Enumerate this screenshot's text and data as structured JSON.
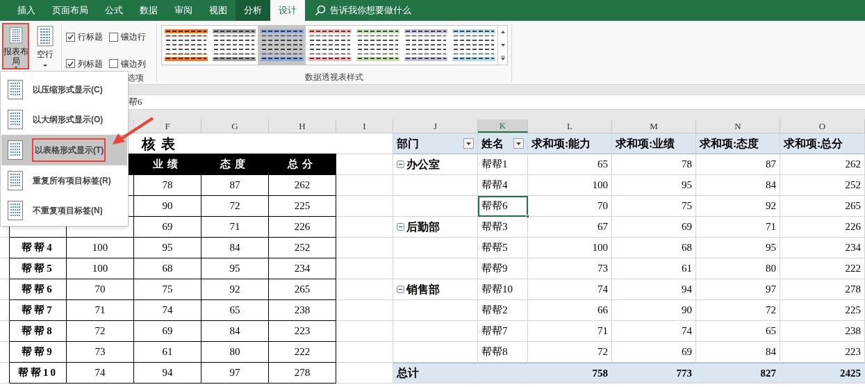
{
  "ribbon_tabs": [
    {
      "label": "插入",
      "kind": "normal",
      "selected": false
    },
    {
      "label": "页面布局",
      "kind": "normal",
      "selected": false
    },
    {
      "label": "公式",
      "kind": "normal",
      "selected": false
    },
    {
      "label": "数据",
      "kind": "normal",
      "selected": false
    },
    {
      "label": "审阅",
      "kind": "normal",
      "selected": false
    },
    {
      "label": "视图",
      "kind": "normal",
      "selected": false
    },
    {
      "label": "分析",
      "kind": "contextual",
      "selected": false
    },
    {
      "label": "设计",
      "kind": "contextual",
      "selected": true
    }
  ],
  "tell_me": {
    "placeholder": "告诉我你想要做什么"
  },
  "ribbon": {
    "layout_button": {
      "label": "报表布局",
      "pressed": true
    },
    "blank_rows_button": {
      "label": "空行"
    },
    "options": [
      {
        "label": "行标题",
        "checked": true
      },
      {
        "label": "镶边行",
        "checked": false
      },
      {
        "label": "列标题",
        "checked": true
      },
      {
        "label": "镶边列",
        "checked": false
      }
    ],
    "options_group_label": "选项",
    "styles": [
      {
        "color": "#ed7d31",
        "selected": false
      },
      {
        "color": "#a5a5a5",
        "selected": false
      },
      {
        "color": "#8eaadb",
        "selected": true
      },
      {
        "color": "#f4b6b6",
        "selected": false
      },
      {
        "color": "#c5e0b4",
        "selected": false
      },
      {
        "color": "#c9c0e0",
        "selected": false
      },
      {
        "color": "#b4dde9",
        "selected": false
      }
    ],
    "styles_group_label": "数据透视表样式"
  },
  "menu": {
    "items": [
      {
        "label": "以压缩形式显示(C)",
        "selected": false
      },
      {
        "label": "以大纲形式显示(O)",
        "selected": false
      },
      {
        "label": "以表格形式显示(T)",
        "selected": true
      },
      {
        "label": "重复所有项目标签(R)",
        "selected": false
      },
      {
        "label": "不重复项目标签(N)",
        "selected": false
      }
    ]
  },
  "formula_bar": {
    "value": "帮6"
  },
  "column_headers": [
    {
      "label": "F",
      "selected": false
    },
    {
      "label": "G",
      "selected": false
    },
    {
      "label": "H",
      "selected": false
    },
    {
      "label": "I",
      "selected": false
    },
    {
      "label": "J",
      "selected": false
    },
    {
      "label": "K",
      "selected": true
    },
    {
      "label": "L",
      "selected": false
    },
    {
      "label": "M",
      "selected": false
    },
    {
      "label": "N",
      "selected": false
    },
    {
      "label": "O",
      "selected": false
    }
  ],
  "score_table": {
    "title": "核表",
    "headers": [
      "业绩",
      "态度",
      "总分"
    ],
    "rows": [
      {
        "values": [
          "78",
          "87",
          "262"
        ]
      },
      {
        "values": [
          "90",
          "72",
          "225"
        ]
      },
      {
        "values": [
          "69",
          "71",
          "226"
        ]
      },
      {
        "name": "帮帮4",
        "ability": "100",
        "values": [
          "95",
          "84",
          "252"
        ]
      },
      {
        "name": "帮帮5",
        "ability": "100",
        "values": [
          "68",
          "95",
          "234"
        ]
      },
      {
        "name": "帮帮6",
        "ability": "70",
        "values": [
          "75",
          "92",
          "265"
        ]
      },
      {
        "name": "帮帮7",
        "ability": "71",
        "values": [
          "74",
          "65",
          "238"
        ]
      },
      {
        "name": "帮帮8",
        "ability": "72",
        "values": [
          "69",
          "84",
          "223"
        ]
      },
      {
        "name": "帮帮9",
        "ability": "73",
        "values": [
          "61",
          "80",
          "222"
        ]
      },
      {
        "name": "帮帮10",
        "ability": "74",
        "values": [
          "94",
          "97",
          "278"
        ]
      }
    ]
  },
  "pivot": {
    "headers": [
      "部门",
      "姓名",
      "求和项:能力",
      "求和项:业绩",
      "求和项:态度",
      "求和项:总分"
    ],
    "groups": [
      {
        "department": "办公室",
        "expanded": true,
        "rows": [
          {
            "name": "帮帮1",
            "values": [
              "65",
              "78",
              "87",
              "262"
            ],
            "selected": false
          },
          {
            "name": "帮帮4",
            "values": [
              "100",
              "95",
              "84",
              "252"
            ],
            "selected": false
          },
          {
            "name": "帮帮6",
            "values": [
              "70",
              "75",
              "92",
              "265"
            ],
            "selected": true
          }
        ]
      },
      {
        "department": "后勤部",
        "expanded": true,
        "rows": [
          {
            "name": "帮帮3",
            "values": [
              "67",
              "69",
              "71",
              "226"
            ],
            "selected": false
          },
          {
            "name": "帮帮5",
            "values": [
              "100",
              "68",
              "95",
              "234"
            ],
            "selected": false
          },
          {
            "name": "帮帮9",
            "values": [
              "73",
              "61",
              "80",
              "222"
            ],
            "selected": false
          }
        ]
      },
      {
        "department": "销售部",
        "expanded": true,
        "rows": [
          {
            "name": "帮帮10",
            "values": [
              "74",
              "94",
              "97",
              "278"
            ],
            "selected": false
          },
          {
            "name": "帮帮2",
            "values": [
              "66",
              "90",
              "72",
              "225"
            ],
            "selected": false
          },
          {
            "name": "帮帮7",
            "values": [
              "71",
              "74",
              "65",
              "238"
            ],
            "selected": false
          },
          {
            "name": "帮帮8",
            "values": [
              "72",
              "69",
              "84",
              "223"
            ],
            "selected": false
          }
        ]
      }
    ],
    "total": {
      "label": "总计",
      "values": [
        "758",
        "773",
        "827",
        "2425"
      ]
    }
  }
}
